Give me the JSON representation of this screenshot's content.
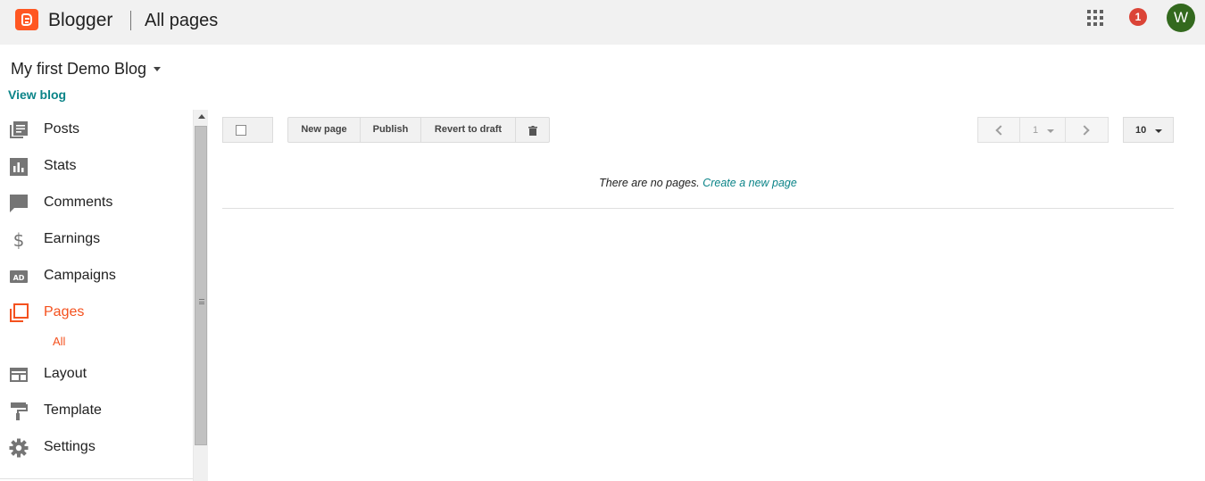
{
  "header": {
    "app_name": "Blogger",
    "page_title": "All pages",
    "notification_count": "1",
    "avatar_letter": "W"
  },
  "blog": {
    "name": "My first Demo Blog",
    "view_blog": "View blog"
  },
  "sidebar": {
    "items": [
      {
        "label": "Posts",
        "icon": "posts-icon"
      },
      {
        "label": "Stats",
        "icon": "stats-icon"
      },
      {
        "label": "Comments",
        "icon": "comments-icon"
      },
      {
        "label": "Earnings",
        "icon": "dollar-icon"
      },
      {
        "label": "Campaigns",
        "icon": "ad-icon"
      },
      {
        "label": "Pages",
        "icon": "pages-icon",
        "active": true
      },
      {
        "label": "Layout",
        "icon": "layout-icon"
      },
      {
        "label": "Template",
        "icon": "paint-roller-icon"
      },
      {
        "label": "Settings",
        "icon": "gear-icon"
      }
    ],
    "sub_item": "All"
  },
  "toolbar": {
    "new_page": "New page",
    "publish": "Publish",
    "revert": "Revert to draft"
  },
  "pagination": {
    "current_page": "1",
    "per_page": "10"
  },
  "empty_state": {
    "message": "There are no pages.",
    "link": "Create a new page"
  },
  "colors": {
    "brand": "#ff5722",
    "active": "#f4511e",
    "link": "#0b8488",
    "notification": "#db4437",
    "avatar": "#33691e"
  }
}
